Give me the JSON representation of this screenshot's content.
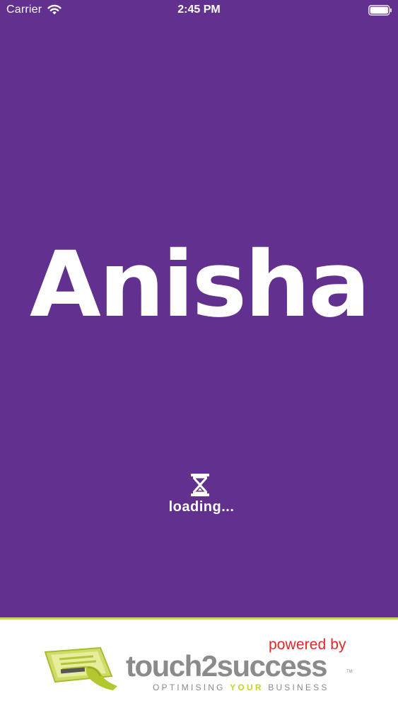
{
  "status_bar": {
    "carrier": "Carrier",
    "time": "2:45 PM"
  },
  "splash": {
    "title": "Anisha",
    "loading_text": "loading...",
    "background_color": "#62308e"
  },
  "footer": {
    "powered_by": "powered by",
    "brand": "touch2success",
    "trademark": "TM",
    "tagline_before": "OPTIMISING ",
    "tagline_highlight": "YOUR",
    "tagline_after": " BUSINESS",
    "accent_color": "#c9d42a",
    "powered_by_color": "#e0282b"
  },
  "icons": [
    "wifi-icon",
    "battery-icon",
    "hourglass-icon",
    "touch2success-device-logo"
  ]
}
